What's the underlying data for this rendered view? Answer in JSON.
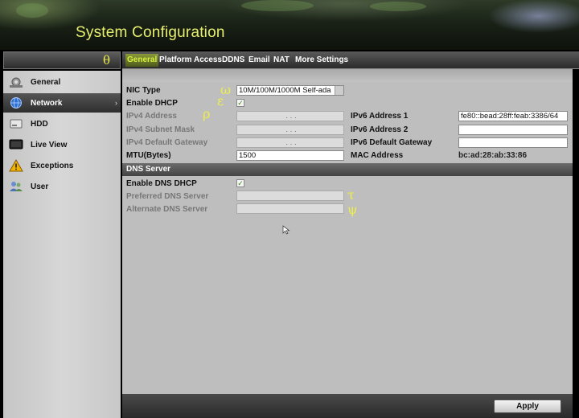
{
  "window": {
    "title": "System Configuration"
  },
  "annotations": {
    "theta": "θ",
    "omega": "ω",
    "epsilon": "ε",
    "rho": "ρ",
    "tau": "τ",
    "psi": "ψ"
  },
  "sidebar": {
    "items": [
      {
        "label": "General",
        "icon": "gear-icon",
        "active": false
      },
      {
        "label": "Network",
        "icon": "globe-icon",
        "active": true
      },
      {
        "label": "HDD",
        "icon": "disk-icon",
        "active": false
      },
      {
        "label": "Live View",
        "icon": "monitor-icon",
        "active": false
      },
      {
        "label": "Exceptions",
        "icon": "warning-icon",
        "active": false
      },
      {
        "label": "User",
        "icon": "users-icon",
        "active": false
      }
    ],
    "active_arrow": "›"
  },
  "tabs": [
    {
      "label": "General",
      "active": true
    },
    {
      "label": "Platform Access",
      "active": false
    },
    {
      "label": "DDNS",
      "active": false
    },
    {
      "label": "Email",
      "active": false
    },
    {
      "label": "NAT",
      "active": false
    },
    {
      "label": "More Settings",
      "active": false
    }
  ],
  "form": {
    "nic_type": {
      "label": "NIC Type",
      "value": "10M/100M/1000M Self-ada"
    },
    "enable_dhcp": {
      "label": "Enable DHCP",
      "checked": true,
      "mark": "✓"
    },
    "ipv4_address": {
      "label": "IPv4 Address",
      "value": ".  .  ."
    },
    "ipv4_subnet": {
      "label": "IPv4 Subnet Mask",
      "value": ".  .  ."
    },
    "ipv4_gateway": {
      "label": "IPv4 Default Gateway",
      "value": ".  .  ."
    },
    "mtu": {
      "label": "MTU(Bytes)",
      "value": "1500"
    },
    "ipv6_address1": {
      "label": "IPv6 Address 1",
      "value": "fe80::bead:28ff:feab:3386/64"
    },
    "ipv6_address2": {
      "label": "IPv6 Address 2",
      "value": ""
    },
    "ipv6_gateway": {
      "label": "IPv6 Default Gateway",
      "value": ""
    },
    "mac_address": {
      "label": "MAC Address",
      "value": "bc:ad:28:ab:33:86"
    }
  },
  "dns": {
    "section_title": "DNS Server",
    "enable_dns_dhcp": {
      "label": "Enable DNS DHCP",
      "checked": true,
      "mark": "✓"
    },
    "preferred": {
      "label": "Preferred DNS Server",
      "value": ""
    },
    "alternate": {
      "label": "Alternate DNS Server",
      "value": ""
    }
  },
  "footer": {
    "apply_label": "Apply"
  },
  "colors": {
    "title": "#e8ef6e",
    "tab_active": "#d8f040",
    "annotation": "#ecee4a"
  }
}
